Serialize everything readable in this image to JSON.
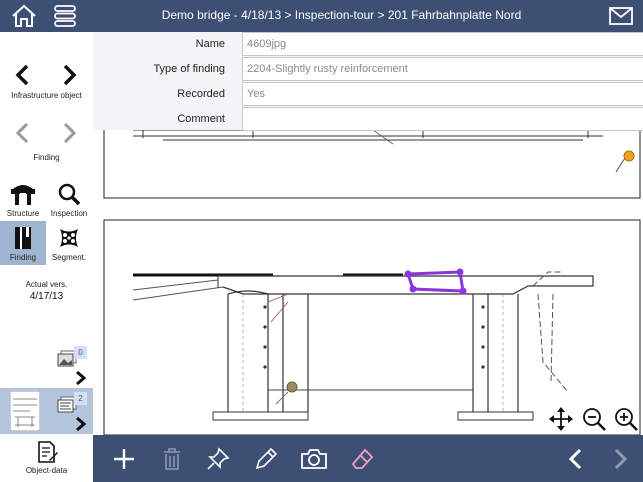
{
  "header": {
    "title": "Demo bridge - 4/18/13 > Inspection-tour > 201 Fahrbahnplatte Nord",
    "home_icon": "home-icon",
    "menu_icon": "menu-icon",
    "mail_icon": "mail-icon"
  },
  "sidebar": {
    "infrastructure_label": "Infrastructure object",
    "finding_nav_label": "Finding",
    "tools": [
      {
        "label": "Structure",
        "icon": "structure-icon"
      },
      {
        "label": "Inspection",
        "icon": "magnifier-icon"
      },
      {
        "label": "Finding",
        "icon": "book-icon"
      },
      {
        "label": "Segment.",
        "icon": "segment-icon"
      }
    ],
    "actual_label": "Actual vers.",
    "actual_date": "4/17/13",
    "attachments": [
      {
        "count": "0",
        "icon": "photo-stack-icon"
      },
      {
        "count": "2",
        "icon": "drawing-stack-icon"
      }
    ],
    "object_data_label": "Object-data"
  },
  "form": {
    "fields": [
      {
        "label": "Name",
        "value": "4609jpg"
      },
      {
        "label": "Type of finding",
        "value": "2204-Slightly rusty reinforcement"
      },
      {
        "label": "Recorded",
        "value": "Yes"
      },
      {
        "label": "Comment",
        "value": ""
      }
    ]
  },
  "toolbar": {
    "icons": [
      "add-icon",
      "trash-icon",
      "pin-icon",
      "pencil-icon",
      "camera-icon",
      "eraser-icon",
      "back-icon",
      "forward-icon"
    ]
  },
  "zoom": {
    "icons": [
      "move-icon",
      "zoom-out-icon",
      "zoom-in-icon"
    ]
  },
  "colors": {
    "bar": "#3d4f73",
    "active_tool": "#9fb4d0",
    "highlight": "#8a35e0",
    "pin_orange": "#f0a020",
    "pin_brown": "#a08a60"
  }
}
